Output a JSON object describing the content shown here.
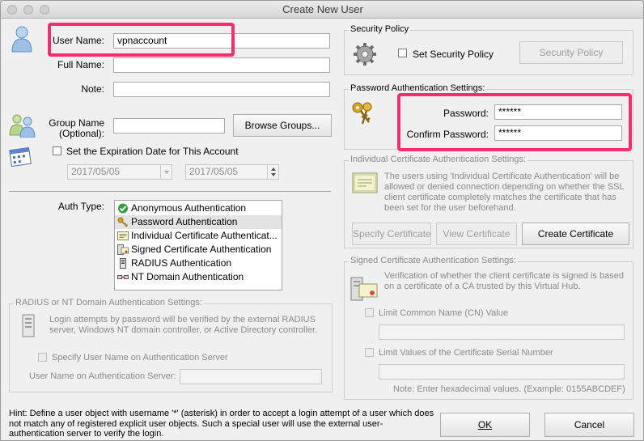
{
  "window": {
    "title": "Create New User"
  },
  "user": {
    "user_name_label": "User Name:",
    "user_name_value": "vpnaccount",
    "full_name_label": "Full Name:",
    "full_name_value": "",
    "note_label": "Note:",
    "note_value": "",
    "group_name_label_1": "Group Name",
    "group_name_label_2": "(Optional):",
    "group_name_value": "",
    "browse_groups_label": "Browse Groups...",
    "expiration_label": "Set the Expiration Date for This Account",
    "expiration_date": "2017/05/05",
    "expiration_time": "2017/05/05"
  },
  "auth": {
    "label": "Auth Type:",
    "items": [
      {
        "label": "Anonymous Authentication",
        "icon": "check-icon"
      },
      {
        "label": "Password Authentication",
        "icon": "key-icon",
        "selected": true
      },
      {
        "label": "Individual Certificate Authenticat...",
        "icon": "certificate-icon"
      },
      {
        "label": "Signed Certificate Authentication",
        "icon": "signed-certificate-icon"
      },
      {
        "label": "RADIUS Authentication",
        "icon": "server-icon"
      },
      {
        "label": "NT Domain Authentication",
        "icon": "network-icon"
      }
    ]
  },
  "radius": {
    "group_title": "RADIUS or NT Domain Authentication Settings:",
    "description": "Login attempts by password will be verified by the external RADIUS server, Windows NT domain controller, or Active Directory controller.",
    "specify_label": "Specify User Name on Authentication Server",
    "server_user_label": "User Name on Authentication Server:",
    "server_user_value": ""
  },
  "security": {
    "group_title": "Security Policy",
    "set_policy_label": "Set Security Policy",
    "policy_button": "Security Policy"
  },
  "password": {
    "group_title": "Password Authentication Settings:",
    "password_label": "Password:",
    "password_value": "******",
    "confirm_label": "Confirm Password:",
    "confirm_value": "******"
  },
  "individual_cert": {
    "group_title": "Individual Certificate Authentication Settings:",
    "description": "The users using 'Individual Certificate Authentication' will be allowed or denied connection depending on whether the SSL client certificate completely matches the certificate that has been set for the user beforehand.",
    "specify_button": "Specify Certificate",
    "view_button": "View Certificate",
    "create_button": "Create Certificate"
  },
  "signed_cert": {
    "group_title": "Signed Certificate Authentication Settings:",
    "description": "Verification of whether the client certificate is signed is based on a certificate of a CA trusted by this Virtual Hub.",
    "limit_cn_label": "Limit Common Name (CN) Value",
    "limit_cn_value": "",
    "limit_serial_label": "Limit Values of the Certificate Serial Number",
    "limit_serial_value": "",
    "note": "Note: Enter hexadecimal values. (Example: 0155ABCDEF)"
  },
  "footer": {
    "hint": "Hint: Define a user object with username '*' (asterisk) in order to accept a login attempt of a user which does not match any of registered explicit user objects. Such a special user will use the external user-authentication server to verify the login.",
    "ok_label": "OK",
    "cancel_label": "Cancel"
  },
  "colors": {
    "highlight": "#f0306e",
    "window_bg": "#f0f0f0"
  }
}
